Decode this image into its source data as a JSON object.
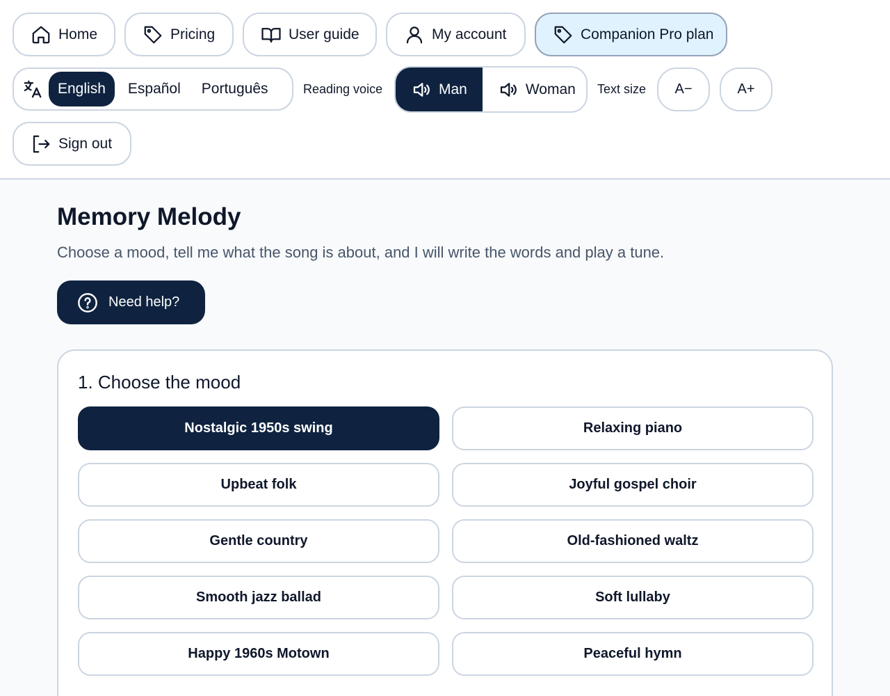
{
  "nav": {
    "home": "Home",
    "pricing": "Pricing",
    "user_guide": "User guide",
    "my_account": "My account",
    "plan": "Companion Pro plan",
    "sign_out": "Sign out"
  },
  "language": {
    "options": [
      "English",
      "Español",
      "Português"
    ],
    "selected": "English"
  },
  "voice": {
    "label": "Reading voice",
    "options": [
      "Man",
      "Woman"
    ],
    "selected": "Man"
  },
  "text_size": {
    "label": "Text size",
    "decrease": "A−",
    "increase": "A+"
  },
  "page": {
    "title": "Memory Melody",
    "subtitle": "Choose a mood, tell me what the song is about, and I will write the words and play a tune.",
    "help": "Need help?"
  },
  "mood": {
    "heading": "1. Choose the mood",
    "selected": "Nostalgic 1950s swing",
    "options": [
      "Nostalgic 1950s swing",
      "Relaxing piano",
      "Upbeat folk",
      "Joyful gospel choir",
      "Gentle country",
      "Old-fashioned waltz",
      "Smooth jazz ballad",
      "Soft lullaby",
      "Happy 1960s Motown",
      "Peaceful hymn"
    ]
  },
  "colors": {
    "accent_dark": "#0f2340",
    "active_nav_bg": "#e0f2fe",
    "border": "#cbd5e1"
  }
}
